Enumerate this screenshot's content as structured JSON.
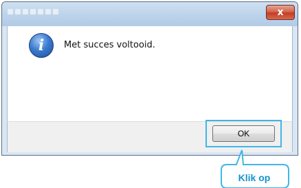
{
  "dialog": {
    "title": "",
    "close_glyph": "x",
    "icon": "info-icon",
    "message": "Met succes voltooid.",
    "ok_label": "OK"
  },
  "annotation": {
    "callout_text": "Klik op",
    "accent_color": "#3fb6e6"
  }
}
